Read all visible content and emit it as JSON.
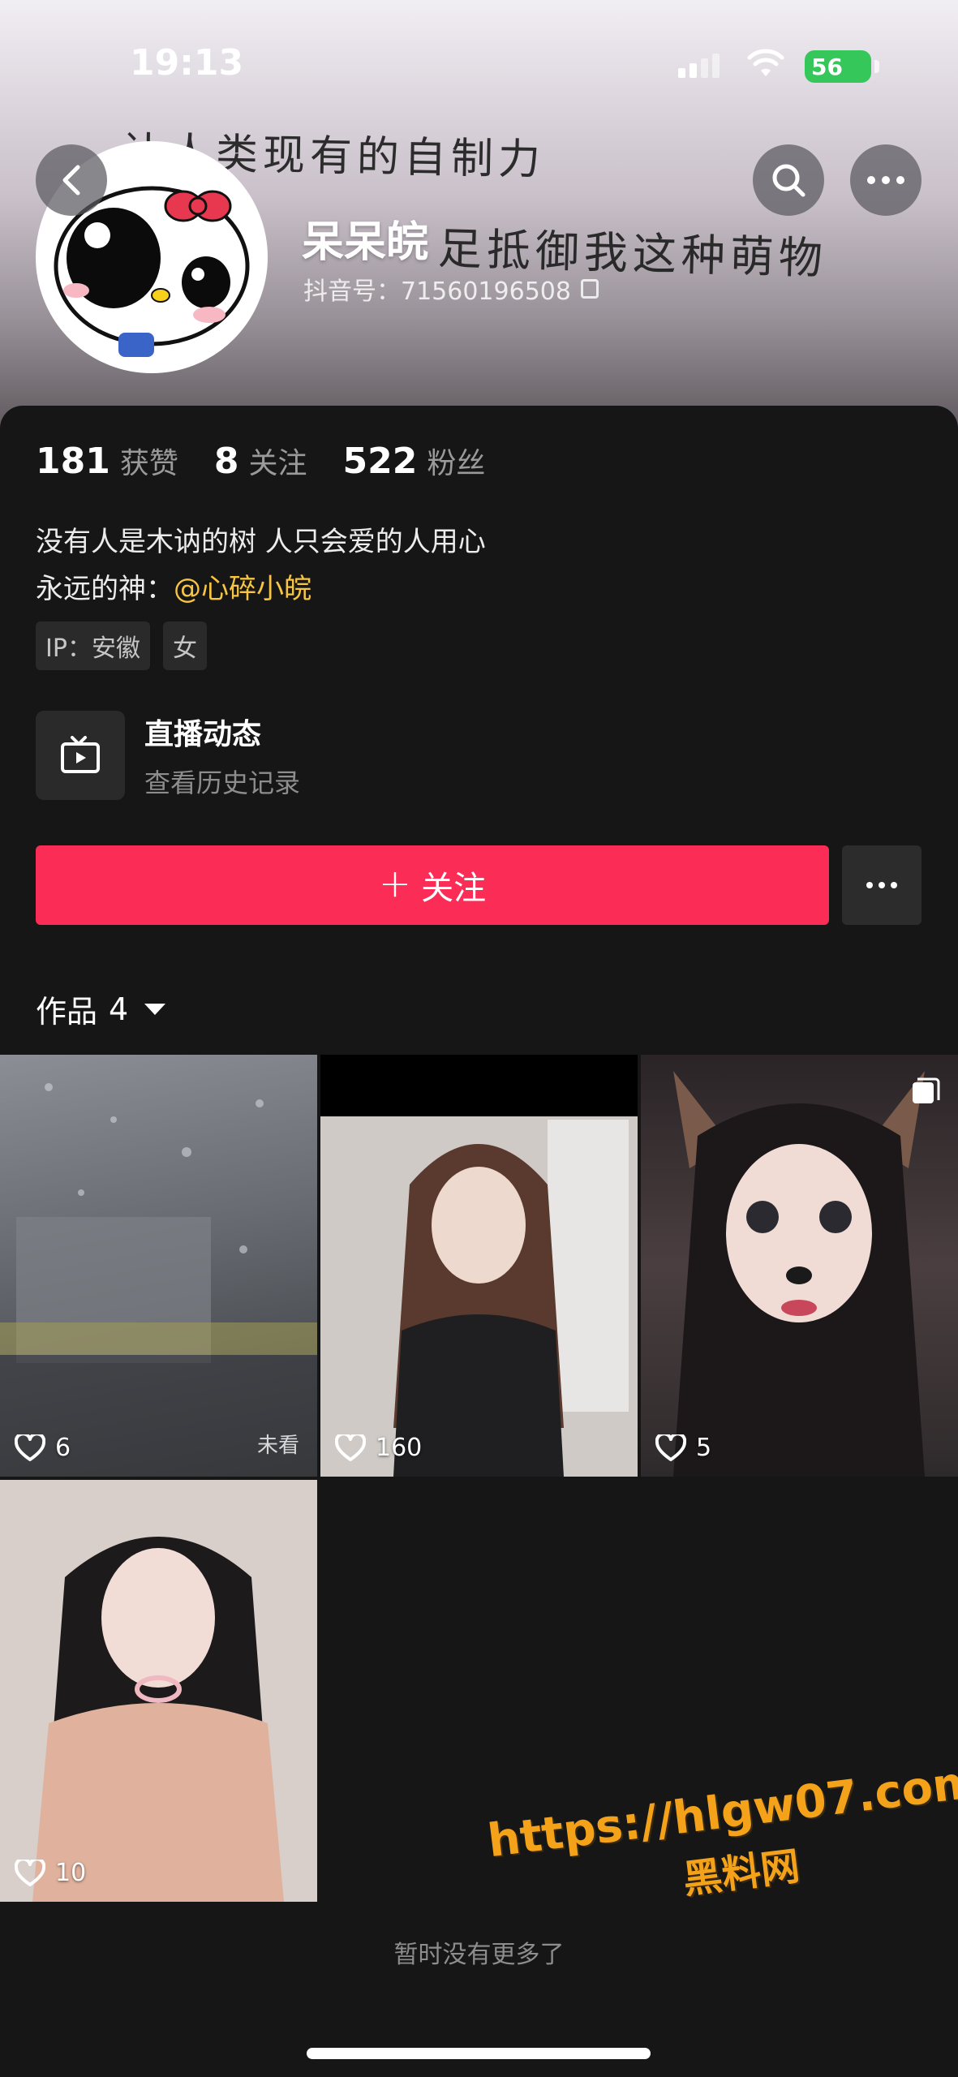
{
  "status_bar": {
    "time": "19:13",
    "battery": "56"
  },
  "banner": {
    "line1": "让人类现有的自制力",
    "line2": "足抵御我这种萌物"
  },
  "profile": {
    "username": "呆呆皖",
    "douyin_id": "抖音号：71560196508",
    "stats": [
      {
        "num": "181",
        "label": "获赞"
      },
      {
        "num": "8",
        "label": "关注"
      },
      {
        "num": "522",
        "label": "粉丝"
      }
    ],
    "bio_line1": "没有人是木讷的树 人只会爱的人用心",
    "bio_line2_prefix": "永远的神：",
    "bio_mention": "@心碎小皖",
    "tags": [
      "IP：安徽",
      "女"
    ]
  },
  "live": {
    "title": "直播动态",
    "subtitle": "查看历史记录"
  },
  "actions": {
    "follow_label": "关注",
    "follow_plus": "+"
  },
  "works": {
    "label": "作品",
    "count": "4"
  },
  "videos": [
    {
      "likes": "6",
      "badge": "未看"
    },
    {
      "likes": "160"
    },
    {
      "likes": "5"
    },
    {
      "likes": "10"
    }
  ],
  "footer": {
    "note": "暂时没有更多了"
  },
  "watermark": {
    "url": "https://hlgw07.com",
    "name": "黑料网"
  },
  "colors": {
    "follow_button": "#fb2c55",
    "mention": "#f6c544",
    "battery": "#35c759"
  }
}
